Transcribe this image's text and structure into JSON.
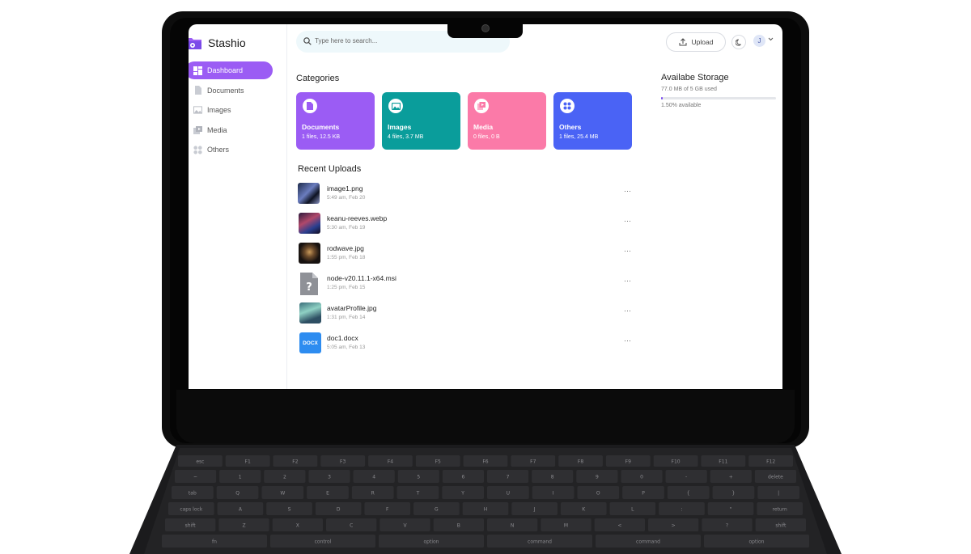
{
  "app": {
    "name": "Stashio"
  },
  "sidebar": {
    "items": [
      {
        "label": "Dashboard",
        "icon": "dashboard-icon",
        "active": true
      },
      {
        "label": "Documents",
        "icon": "document-icon",
        "active": false
      },
      {
        "label": "Images",
        "icon": "image-icon",
        "active": false
      },
      {
        "label": "Media",
        "icon": "media-icon",
        "active": false
      },
      {
        "label": "Others",
        "icon": "others-icon",
        "active": false
      }
    ]
  },
  "header": {
    "search_placeholder": "Type here to search...",
    "upload_label": "Upload",
    "avatar_initial": "J"
  },
  "categories": {
    "title": "Categories",
    "items": [
      {
        "name": "Documents",
        "meta": "1 files, 12.5 KB",
        "color": "#9b5cf4",
        "icon": "document-icon"
      },
      {
        "name": "Images",
        "meta": "4 files, 3.7 MB",
        "color": "#0a9d9b",
        "icon": "image-icon"
      },
      {
        "name": "Media",
        "meta": "0 files, 0 B",
        "color": "#fb7aa8",
        "icon": "media-icon"
      },
      {
        "name": "Others",
        "meta": "1 files, 25.4 MB",
        "color": "#4a63f5",
        "icon": "others-icon"
      }
    ]
  },
  "uploads": {
    "title": "Recent Uploads",
    "more_label": "···",
    "items": [
      {
        "name": "image1.png",
        "date": "5:49 am, Feb 20",
        "thumb": "image"
      },
      {
        "name": "keanu-reeves.webp",
        "date": "5:30 am, Feb 19",
        "thumb": "image"
      },
      {
        "name": "rodwave.jpg",
        "date": "1:55 pm, Feb 18",
        "thumb": "image"
      },
      {
        "name": "node-v20.11.1-x64.msi",
        "date": "1:25 pm, Feb 15",
        "thumb": "unknown-file-icon"
      },
      {
        "name": "avatarProfile.jpg",
        "date": "1:31 pm, Feb 14",
        "thumb": "image"
      },
      {
        "name": "doc1.docx",
        "date": "5:05 am, Feb 13",
        "thumb": "docx-icon",
        "badge": "DOCX"
      }
    ]
  },
  "storage": {
    "title": "Availabe Storage",
    "used": "77.0 MB of 5 GB used",
    "available": "1.50% available",
    "fill_fraction": 0.015
  },
  "keyboard": {
    "fn_row": [
      "esc",
      "F1",
      "F2",
      "F3",
      "F4",
      "F5",
      "F6",
      "F7",
      "F8",
      "F9",
      "F10",
      "F11",
      "F12"
    ],
    "num_row": [
      "~",
      "1",
      "2",
      "3",
      "4",
      "5",
      "6",
      "7",
      "8",
      "9",
      "0",
      "-",
      "+",
      "delete"
    ],
    "q_row": [
      "tab",
      "Q",
      "W",
      "E",
      "R",
      "T",
      "Y",
      "U",
      "I",
      "O",
      "P",
      "{",
      "}",
      "|"
    ],
    "a_row": [
      "caps lock",
      "A",
      "S",
      "D",
      "F",
      "G",
      "H",
      "J",
      "K",
      "L",
      ":",
      "\"",
      "return"
    ],
    "z_row": [
      "shift",
      "Z",
      "X",
      "C",
      "V",
      "B",
      "N",
      "M",
      "<",
      ">",
      "?",
      "shift"
    ],
    "bottom_row": [
      "fn",
      "control",
      "option",
      "command",
      "command",
      "option"
    ]
  }
}
